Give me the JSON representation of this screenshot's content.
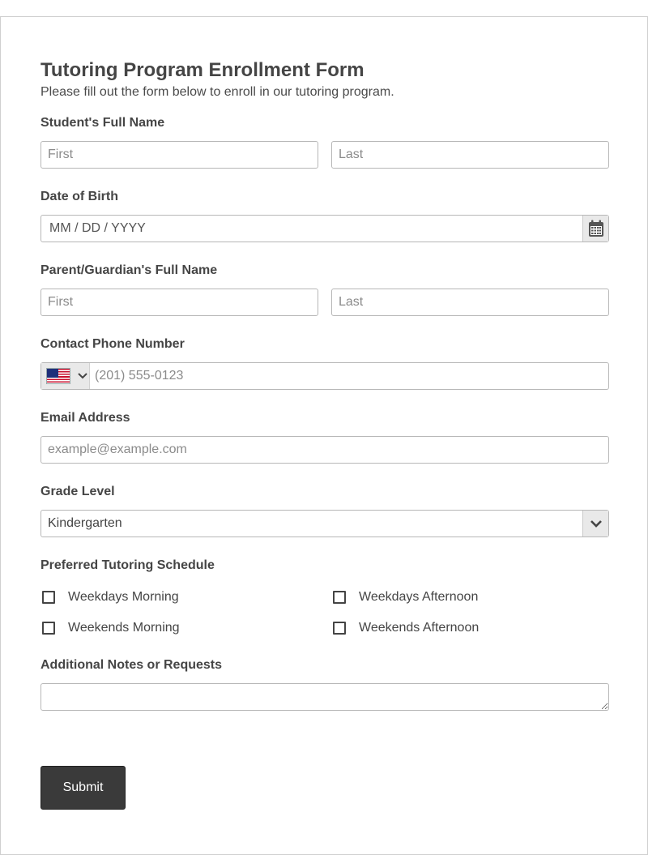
{
  "form": {
    "title": "Tutoring Program Enrollment Form",
    "subtitle": "Please fill out the form below to enroll in our tutoring program."
  },
  "student": {
    "label": "Student's Full Name",
    "first_placeholder": "First",
    "last_placeholder": "Last"
  },
  "dob": {
    "label": "Date of Birth",
    "placeholder": "MM / DD / YYYY",
    "icon": "calendar-icon"
  },
  "parent": {
    "label": "Parent/Guardian's Full Name",
    "first_placeholder": "First",
    "last_placeholder": "Last"
  },
  "phone": {
    "label": "Contact Phone Number",
    "placeholder": "(201) 555-0123",
    "country_icon": "us-flag-icon"
  },
  "email": {
    "label": "Email Address",
    "placeholder": "example@example.com"
  },
  "grade": {
    "label": "Grade Level",
    "selected": "Kindergarten"
  },
  "schedule": {
    "label": "Preferred Tutoring Schedule",
    "options": [
      {
        "label": "Weekdays Morning",
        "checked": false
      },
      {
        "label": "Weekdays Afternoon",
        "checked": false
      },
      {
        "label": "Weekends Morning",
        "checked": false
      },
      {
        "label": "Weekends Afternoon",
        "checked": false
      }
    ]
  },
  "notes": {
    "label": "Additional Notes or Requests",
    "value": ""
  },
  "submit": {
    "label": "Submit",
    "color": "#3a3a3a"
  }
}
